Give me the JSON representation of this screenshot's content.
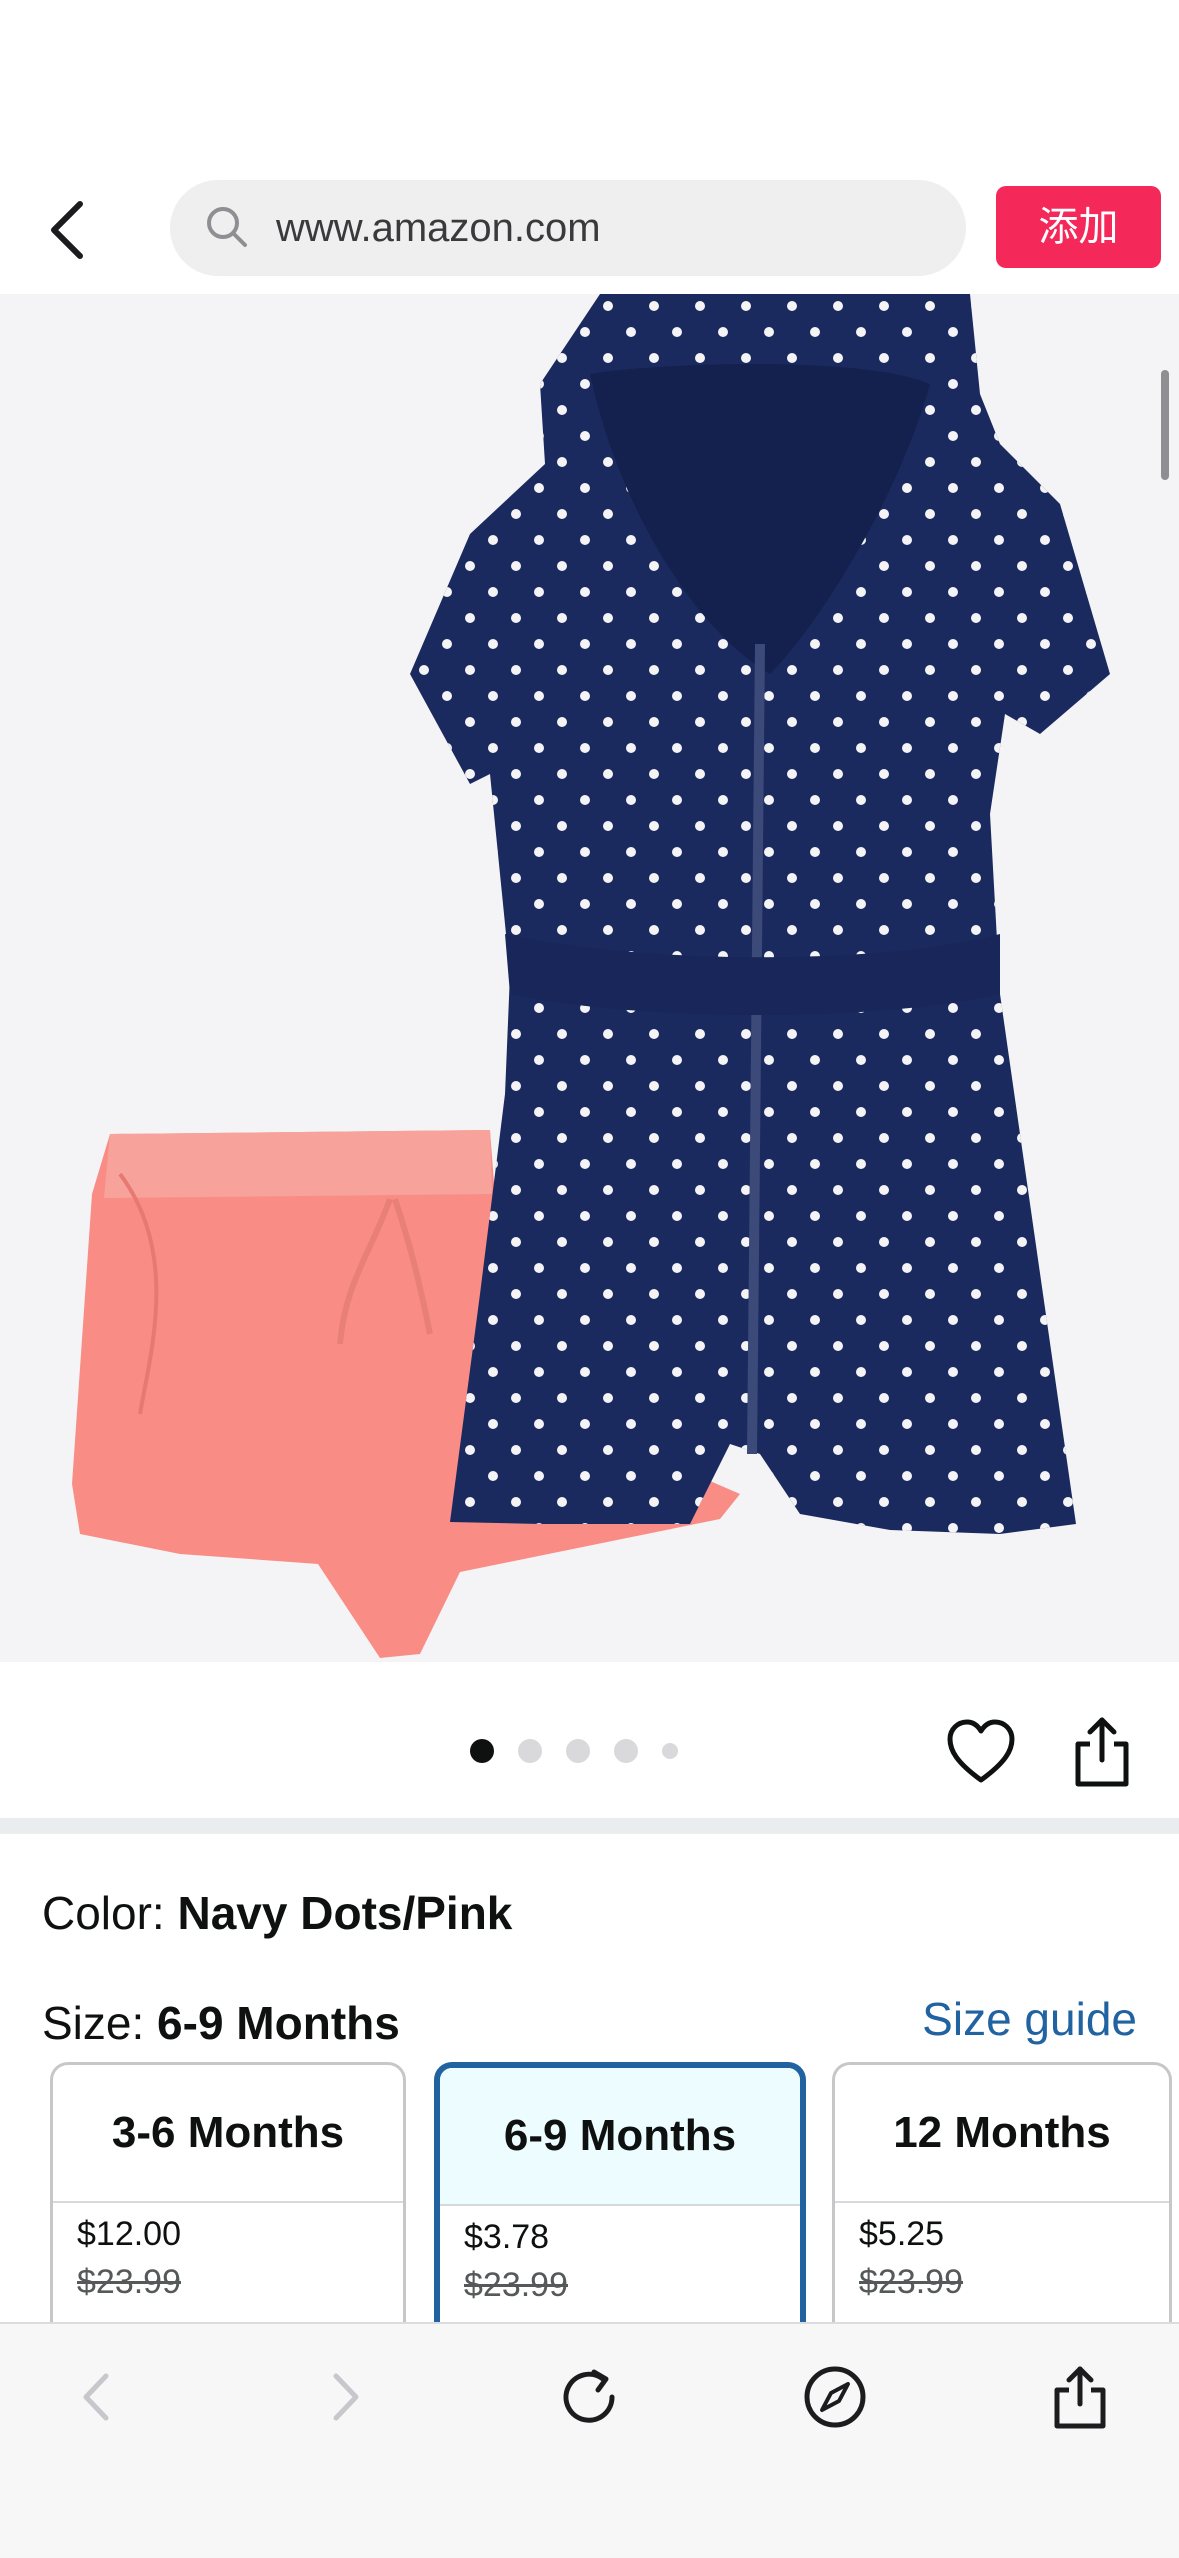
{
  "browser": {
    "url": "www.amazon.com",
    "add_button_label": "添加",
    "back_icon": "chevron-left-icon",
    "search_icon": "search-icon"
  },
  "gallery": {
    "dots_total": 5,
    "active_index": 0
  },
  "product": {
    "color_label": "Color:",
    "color_value": "Navy Dots/Pink",
    "size_label": "Size:",
    "size_value": "6-9 Months",
    "size_guide_link": "Size guide",
    "sizes": [
      {
        "label": "3-6 Months",
        "price": "$12.00",
        "list_price": "$23.99",
        "selected": false
      },
      {
        "label": "6-9 Months",
        "price": "$3.78",
        "list_price": "$23.99",
        "selected": true
      },
      {
        "label": "12 Months",
        "price": "$5.25",
        "list_price": "$23.99",
        "selected": false
      }
    ]
  },
  "colors": {
    "accent_pink": "#f5285a",
    "link_blue": "#2162a1",
    "navy": "#1b2a5e",
    "pink_shorts": "#f98d86"
  },
  "toolbar": {
    "icons": [
      "back-icon",
      "forward-icon",
      "reload-icon",
      "compass-icon",
      "share-icon"
    ]
  }
}
